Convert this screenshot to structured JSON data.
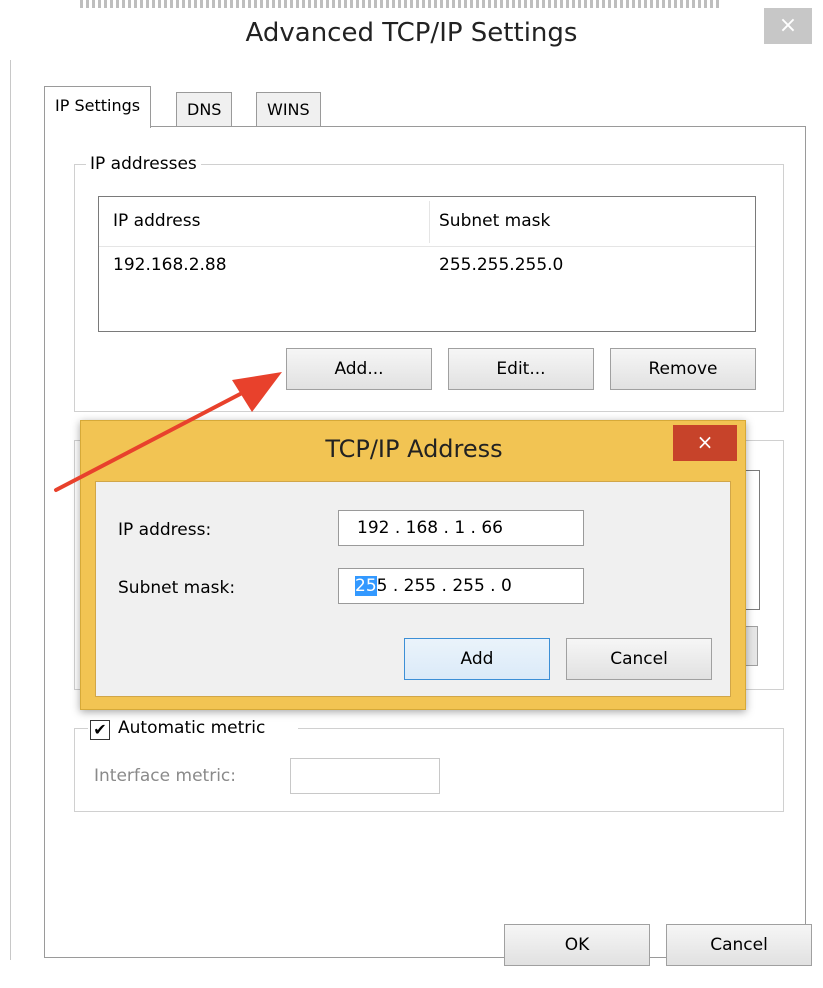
{
  "window": {
    "title": "Advanced TCP/IP Settings",
    "close_label": "×"
  },
  "tabs": [
    {
      "label": "IP Settings",
      "active": true
    },
    {
      "label": "DNS",
      "active": false
    },
    {
      "label": "WINS",
      "active": false
    }
  ],
  "ip_group": {
    "label": "IP addresses",
    "columns": [
      "IP address",
      "Subnet mask"
    ],
    "rows": [
      {
        "ip": "192.168.2.88",
        "mask": "255.255.255.0"
      }
    ],
    "buttons": {
      "add": "Add...",
      "edit": "Edit...",
      "remove": "Remove"
    }
  },
  "dialog": {
    "title": "TCP/IP Address",
    "close_label": "×",
    "ip_label": "IP address:",
    "ip_value": "192 . 168 .  1  . 66",
    "mask_label": "Subnet mask:",
    "mask_value_selected": "25",
    "mask_value_rest": "5 . 255 . 255 .  0",
    "add_button": "Add",
    "cancel_button": "Cancel"
  },
  "metric": {
    "auto_label": "Automatic metric",
    "auto_checked": true,
    "interface_label": "Interface metric:"
  },
  "footer": {
    "ok": "OK",
    "cancel": "Cancel"
  },
  "colors": {
    "dialog_frame": "#f2c453",
    "dialog_close": "#c7432a",
    "arrow": "#e8412c",
    "selection": "#3399ff"
  }
}
